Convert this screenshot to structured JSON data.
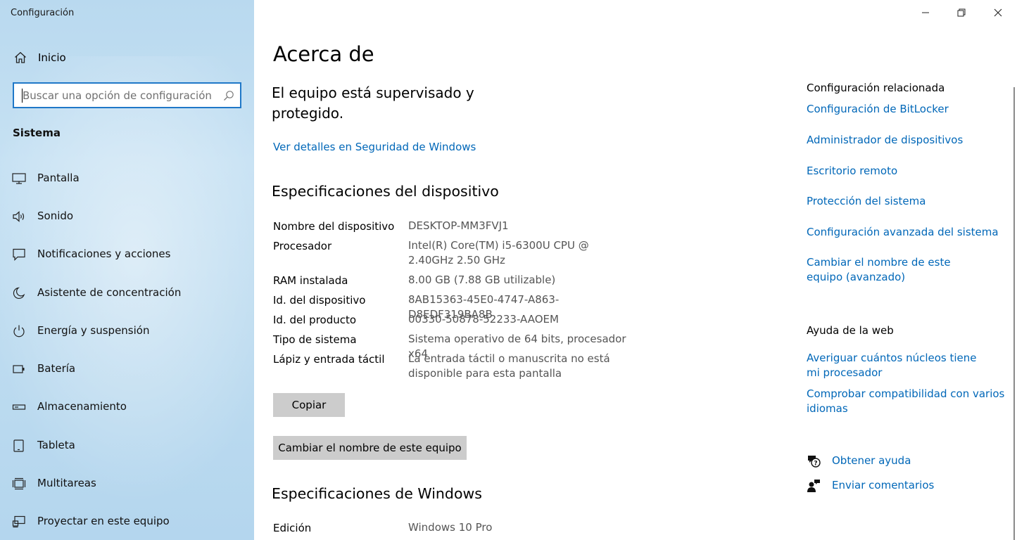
{
  "app": {
    "title": "Configuración"
  },
  "sidebar": {
    "home_label": "Inicio",
    "search_placeholder": "Buscar una opción de configuración",
    "section_title": "Sistema",
    "items": [
      {
        "label": "Pantalla",
        "icon": "monitor-icon"
      },
      {
        "label": "Sonido",
        "icon": "speaker-icon"
      },
      {
        "label": "Notificaciones y acciones",
        "icon": "notification-icon"
      },
      {
        "label": "Asistente de concentración",
        "icon": "moon-icon"
      },
      {
        "label": "Energía y suspensión",
        "icon": "power-icon"
      },
      {
        "label": "Batería",
        "icon": "battery-icon"
      },
      {
        "label": "Almacenamiento",
        "icon": "storage-icon"
      },
      {
        "label": "Tableta",
        "icon": "tablet-icon"
      },
      {
        "label": "Multitareas",
        "icon": "multitask-icon"
      },
      {
        "label": "Proyectar en este equipo",
        "icon": "project-icon"
      }
    ]
  },
  "main": {
    "title": "Acerca de",
    "protection_status": "El equipo está supervisado y protegido.",
    "security_link": "Ver detalles en Seguridad de Windows",
    "device_specs_title": "Especificaciones del dispositivo",
    "device_specs": [
      {
        "label": "Nombre del dispositivo",
        "value": "DESKTOP-MM3FVJ1"
      },
      {
        "label": "Procesador",
        "value": "Intel(R) Core(TM) i5-6300U CPU @ 2.40GHz 2.50 GHz"
      },
      {
        "label": "RAM instalada",
        "value": "8.00 GB (7.88 GB utilizable)"
      },
      {
        "label": "Id. del dispositivo",
        "value": "8AB15363-45E0-4747-A863-D8EDF319BA8B"
      },
      {
        "label": "Id. del producto",
        "value": "00330-50878-52233-AAOEM"
      },
      {
        "label": "Tipo de sistema",
        "value": "Sistema operativo de 64 bits, procesador x64"
      },
      {
        "label": "Lápiz y entrada táctil",
        "value": "La entrada táctil o manuscrita no está disponible para esta pantalla"
      }
    ],
    "copy_button": "Copiar",
    "rename_button": "Cambiar el nombre de este equipo",
    "windows_specs_title": "Especificaciones de Windows",
    "windows_specs": [
      {
        "label": "Edición",
        "value": "Windows 10 Pro"
      }
    ]
  },
  "related": {
    "title": "Configuración relacionada",
    "links": [
      "Configuración de BitLocker",
      "Administrador de dispositivos",
      "Escritorio remoto",
      "Protección del sistema",
      "Configuración avanzada del sistema",
      "Cambiar el nombre de este equipo (avanzado)"
    ]
  },
  "web_help": {
    "title": "Ayuda de la web",
    "links": [
      "Averiguar cuántos núcleos tiene mi procesador",
      "Comprobar compatibilidad con varios idiomas"
    ]
  },
  "help": {
    "get_help": "Obtener ayuda",
    "feedback": "Enviar comentarios"
  },
  "colors": {
    "accent": "#0067b8",
    "search_border": "#1f78c8",
    "button_bg": "#cccccc"
  }
}
